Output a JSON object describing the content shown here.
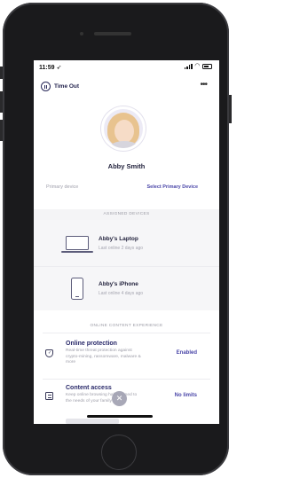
{
  "status_bar": {
    "time": "11:59 ➶",
    "wifi_icon": "wifi-icon",
    "battery_icon": "battery-icon"
  },
  "top_bar": {
    "time_out_label": "Time Out",
    "more_label": "•••"
  },
  "profile": {
    "name": "Abby Smith"
  },
  "primary_device": {
    "label": "Primary device",
    "link": "Select Primary Device"
  },
  "assigned_devices": {
    "header": "ASSIGNED DEVICES",
    "items": [
      {
        "name": "Abby's Laptop",
        "status": "Last online 2 days ago",
        "icon": "laptop-icon"
      },
      {
        "name": "Abby's iPhone",
        "status": "Last online 4 days ago",
        "icon": "phone-icon"
      }
    ]
  },
  "online_content": {
    "header": "ONLINE CONTENT EXPERIENCE",
    "items": [
      {
        "title": "Online protection",
        "description": "Real-time threat protection against crypto-mining, ransomware, malware & more",
        "value": "Enabled",
        "icon": "shield-check-icon"
      },
      {
        "title": "Content access",
        "description": "Keep online browsing habits tuned to the needs of your family",
        "value": "No limits",
        "icon": "content-filter-icon"
      }
    ]
  },
  "overlay": {
    "close_glyph": "✕"
  }
}
